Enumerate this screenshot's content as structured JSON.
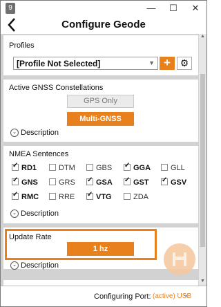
{
  "window": {
    "app_icon": "9",
    "minimize": "—",
    "maximize": "☐",
    "close": "✕"
  },
  "header": {
    "title": "Configure Geode"
  },
  "profiles": {
    "title": "Profiles",
    "selected": "[Profile Not Selected]",
    "add_label": "+",
    "settings_icon": "gear-icon"
  },
  "gnss": {
    "title": "Active GNSS Constellations",
    "gps_only": "GPS Only",
    "multi_gnss": "Multi-GNSS",
    "description": "Description"
  },
  "nmea": {
    "title": "NMEA Sentences",
    "items": [
      {
        "label": "RD1",
        "checked": true
      },
      {
        "label": "DTM",
        "checked": false
      },
      {
        "label": "GBS",
        "checked": false
      },
      {
        "label": "GGA",
        "checked": true
      },
      {
        "label": "GLL",
        "checked": false
      },
      {
        "label": "GNS",
        "checked": true
      },
      {
        "label": "GRS",
        "checked": false
      },
      {
        "label": "GSA",
        "checked": true
      },
      {
        "label": "GST",
        "checked": true
      },
      {
        "label": "GSV",
        "checked": true
      },
      {
        "label": "RMC",
        "checked": true
      },
      {
        "label": "RRE",
        "checked": false
      },
      {
        "label": "VTG",
        "checked": true
      },
      {
        "label": "ZDA",
        "checked": false
      }
    ],
    "description": "Description"
  },
  "update_rate": {
    "title": "Update Rate",
    "value": "1 hz",
    "description": "Description"
  },
  "footer": {
    "label": "Configuring Port:",
    "port": "(active) USB"
  },
  "colors": {
    "accent": "#e8801b"
  }
}
